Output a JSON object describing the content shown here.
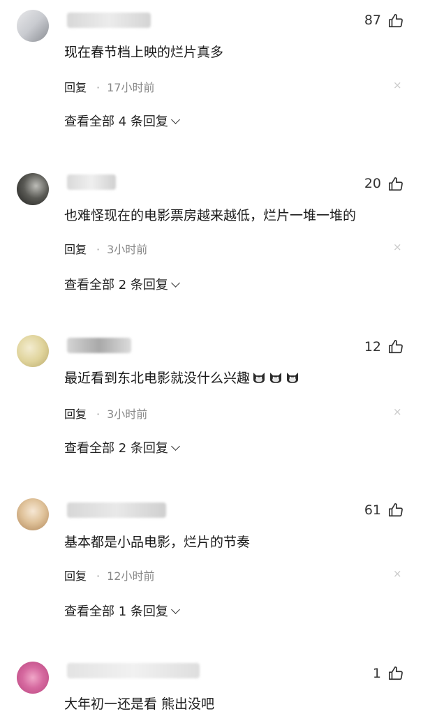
{
  "comments": [
    {
      "likes": "87",
      "text": "现在春节档上映的烂片真多",
      "reply_label": "回复",
      "time": "17小时前",
      "view_replies": "查看全部 4 条回复",
      "close": "×"
    },
    {
      "likes": "20",
      "text": "也难怪现在的电影票房越来越低，烂片一堆一堆的",
      "reply_label": "回复",
      "time": "3小时前",
      "view_replies": "查看全部 2 条回复",
      "close": "×"
    },
    {
      "likes": "12",
      "text": "最近看到东北电影就没什么兴趣",
      "reply_label": "回复",
      "time": "3小时前",
      "view_replies": "查看全部 2 条回复",
      "close": "×"
    },
    {
      "likes": "61",
      "text": "基本都是小品电影，烂片的节奏",
      "reply_label": "回复",
      "time": "12小时前",
      "view_replies": "查看全部 1 条回复",
      "close": "×"
    },
    {
      "likes": "1",
      "text": "大年初一还是看 熊出没吧"
    }
  ],
  "icons": {
    "like": "thumbs-up-icon",
    "emoji": "cat-face-emoji-icon"
  }
}
